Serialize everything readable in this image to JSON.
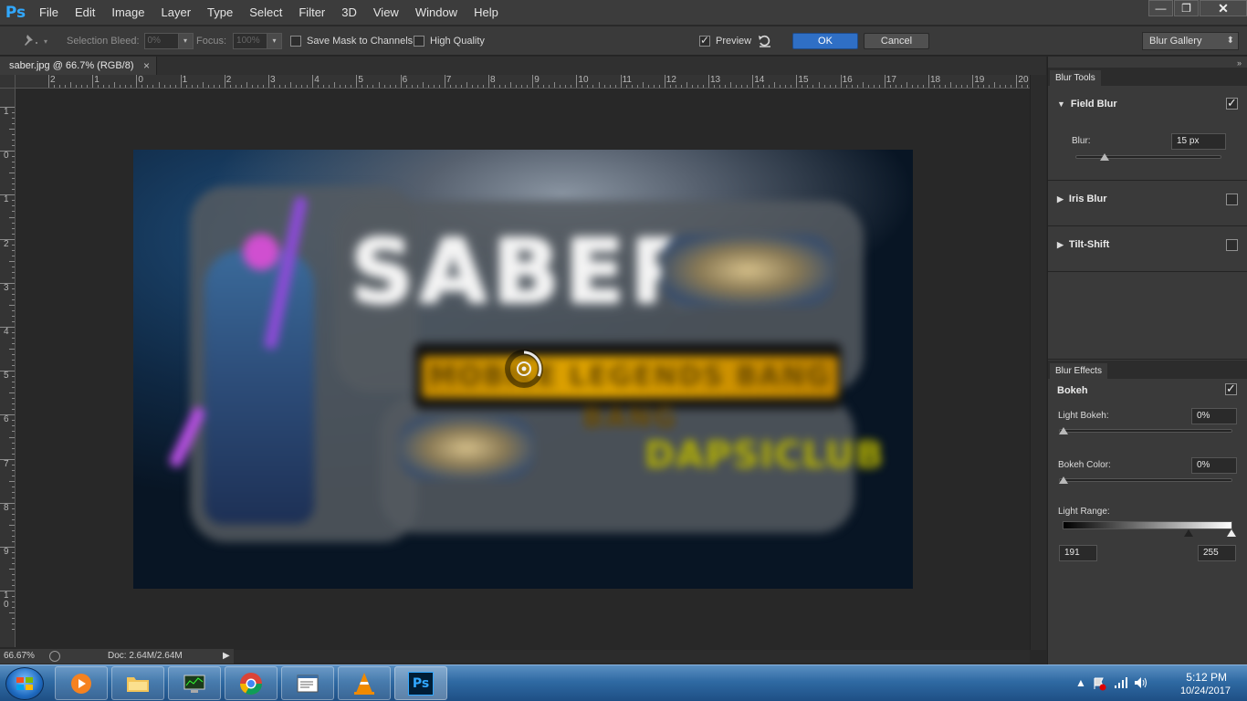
{
  "app": {
    "logo": "Ps"
  },
  "menu": [
    "File",
    "Edit",
    "Image",
    "Layer",
    "Type",
    "Select",
    "Filter",
    "3D",
    "View",
    "Window",
    "Help"
  ],
  "window_controls": {
    "minimize": "—",
    "restore": "❐",
    "close": "✕"
  },
  "options_bar": {
    "selection_bleed_label": "Selection Bleed:",
    "selection_bleed_value": "0%",
    "focus_label": "Focus:",
    "focus_value": "100%",
    "save_mask_label": "Save Mask to Channels",
    "high_quality_label": "High Quality",
    "preview_label": "Preview",
    "preview_checked": true,
    "ok_label": "OK",
    "cancel_label": "Cancel",
    "workspace_value": "Blur Gallery"
  },
  "document": {
    "tab_title": "saber.jpg @ 66.7% (RGB/8)",
    "tab_close": "×",
    "image_text_title": "SABER",
    "image_text_banner": "MOBILE LEGENDS BANG BANG",
    "image_text_sub": "DAPSICLUB"
  },
  "rulers": {
    "top_labels": [
      "2",
      "1",
      "0",
      "1",
      "2",
      "3",
      "4",
      "5",
      "6",
      "7",
      "8",
      "9",
      "10",
      "11",
      "12",
      "13",
      "14",
      "15",
      "16",
      "17",
      "18",
      "19",
      "20"
    ],
    "left_labels": [
      "1",
      "0",
      "1",
      "2",
      "3",
      "4",
      "5",
      "6",
      "7",
      "8",
      "9",
      "1 0"
    ]
  },
  "status": {
    "zoom": "66.67%",
    "doc_size": "Doc: 2.64M/2.64M",
    "arrow": "▶"
  },
  "panel": {
    "collapse": "»",
    "blur_tools_tab": "Blur Tools",
    "field_blur": {
      "title": "Field Blur",
      "checked": true,
      "blur_label": "Blur:",
      "blur_value": "15 px",
      "blur_fraction": 0.2
    },
    "iris_blur": {
      "title": "Iris Blur",
      "checked": false
    },
    "tilt_shift": {
      "title": "Tilt-Shift",
      "checked": false
    },
    "blur_effects_tab": "Blur Effects",
    "bokeh": {
      "title": "Bokeh",
      "checked": true,
      "light_bokeh_label": "Light Bokeh:",
      "light_bokeh_value": "0%",
      "bokeh_color_label": "Bokeh Color:",
      "bokeh_color_value": "0%",
      "light_range_label": "Light Range:",
      "light_range_low": "191",
      "light_range_high": "255"
    }
  },
  "taskbar": {
    "apps": [
      "media-player",
      "file-explorer",
      "task-manager",
      "chrome",
      "notepad",
      "vlc",
      "photoshop"
    ],
    "active_app": "photoshop",
    "ps_label": "Ps",
    "time": "5:12 PM",
    "date": "10/24/2017"
  },
  "colors": {
    "accent": "#31a8ff",
    "ok_button": "#2f6fc5",
    "taskbar": "#2f6aa3"
  }
}
